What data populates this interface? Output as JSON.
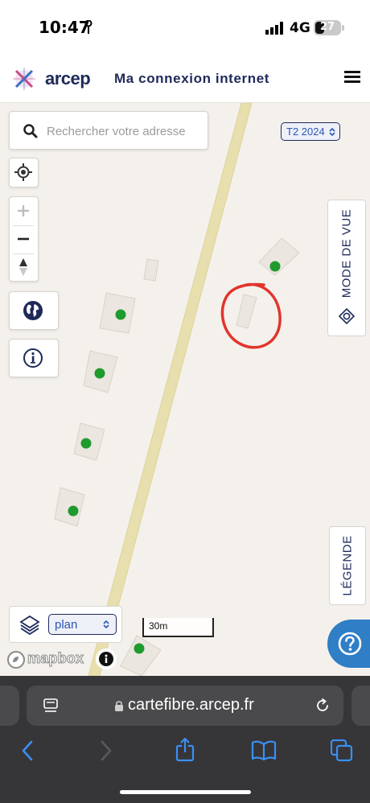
{
  "status_bar": {
    "time": "10:47",
    "network": "4G",
    "battery": "27"
  },
  "header": {
    "logo": "arcep",
    "title": "Ma connexion internet"
  },
  "search": {
    "placeholder": "Rechercher votre adresse"
  },
  "period_select": {
    "value": "T2 2024"
  },
  "view_mode": {
    "label": "MODE DE VUE"
  },
  "legend": {
    "label": "LÉGENDE"
  },
  "layer_select": {
    "value": "plan"
  },
  "scale": {
    "label": "30m"
  },
  "attribution": {
    "brand": "mapbox"
  },
  "browser": {
    "url": "cartefibre.arcep.fr"
  },
  "colors": {
    "brand": "#1e2a5a",
    "link": "#2a55b8",
    "fiber_dot": "#1f9a2c",
    "annotation": "#e2342d",
    "help": "#2f7ec6",
    "road": "#e8dfae"
  }
}
